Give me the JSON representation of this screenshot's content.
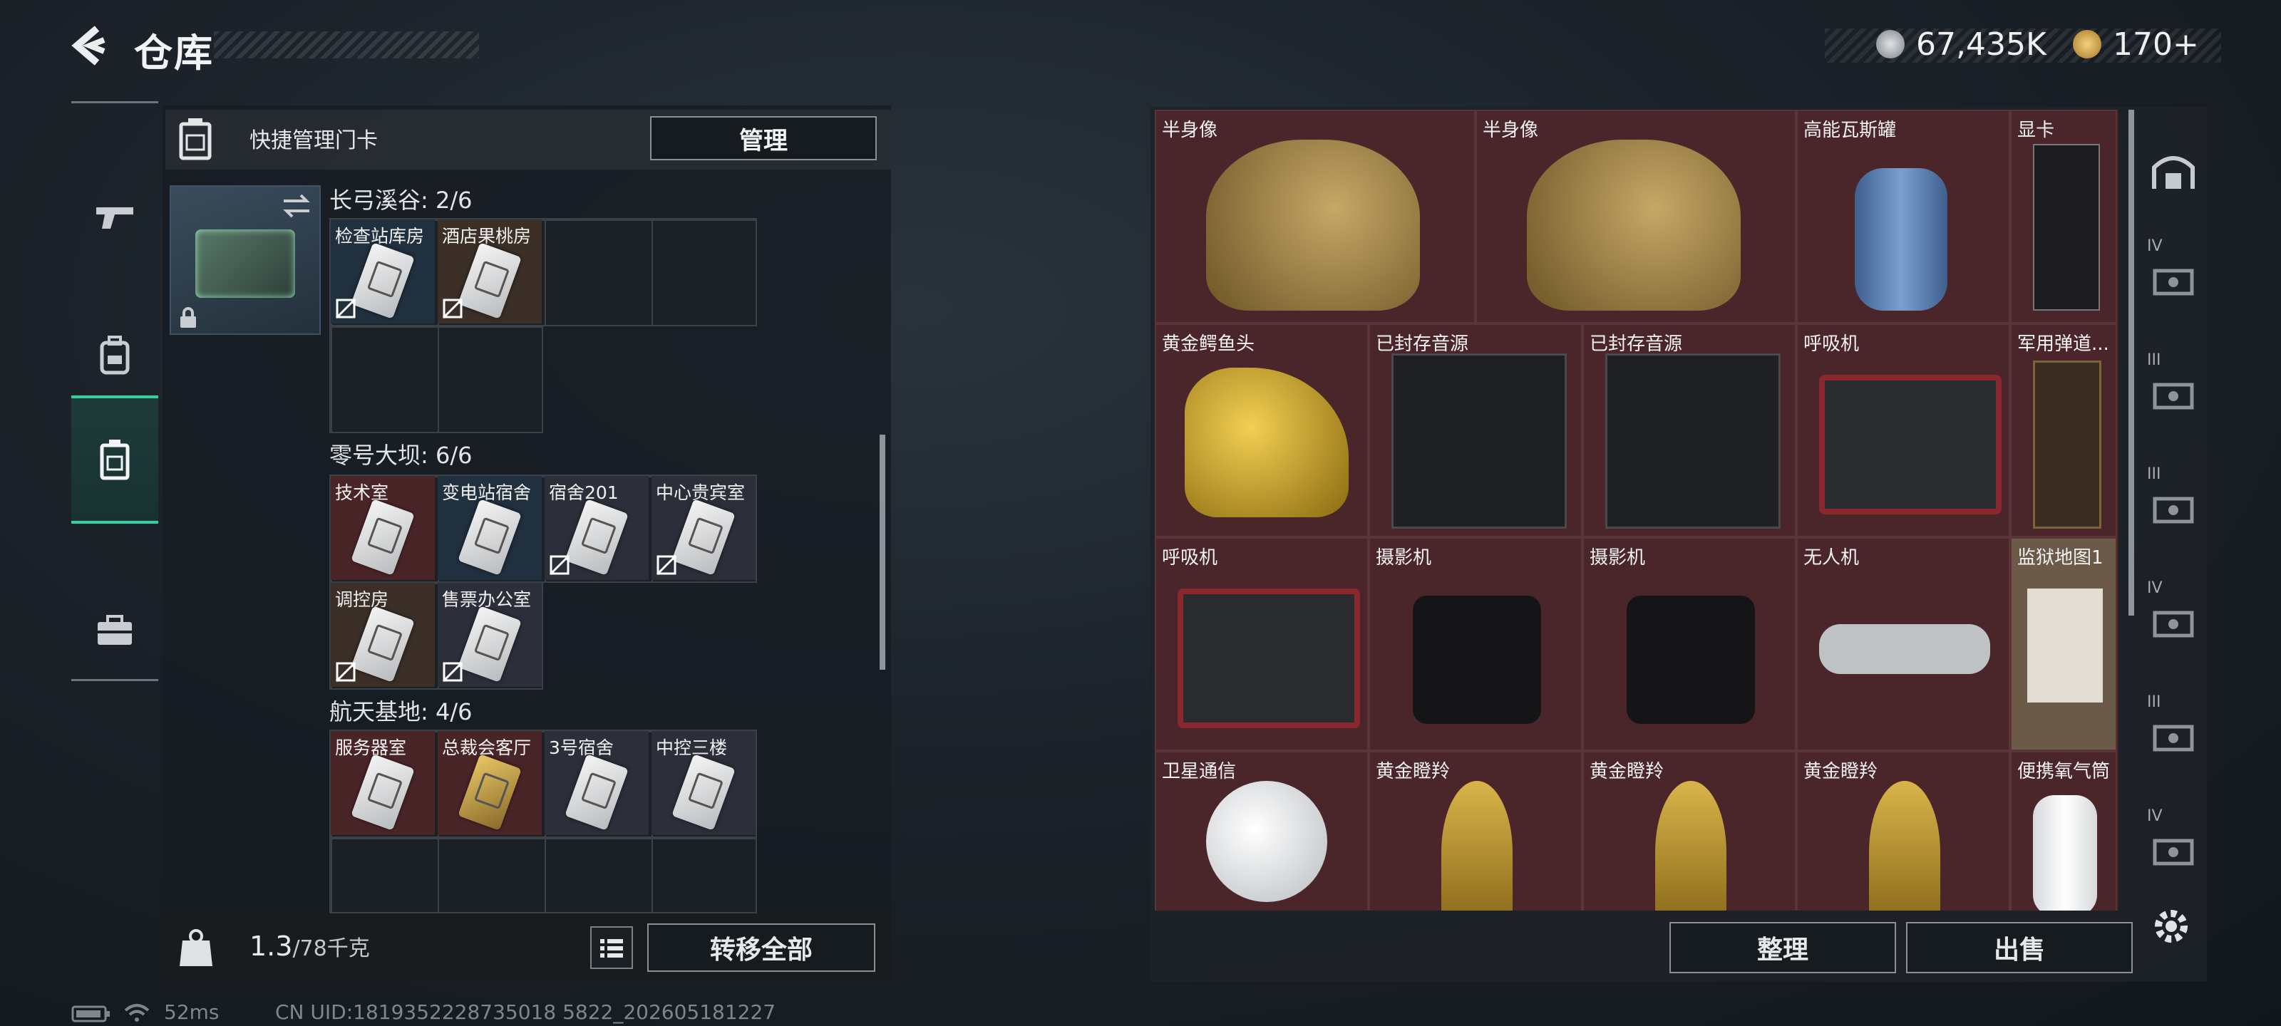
{
  "header": {
    "title": "仓库"
  },
  "currency": {
    "silver": "67,435K",
    "gold": "170+"
  },
  "left_nav": {
    "items": [
      "weapon-tab",
      "equipment-tab",
      "keycard-tab",
      "briefcase-tab"
    ],
    "active": "keycard-tab"
  },
  "quick_panel": {
    "label": "快捷管理门卡",
    "manage_button": "管理"
  },
  "locations": [
    {
      "title": "长弓溪谷: 2/6",
      "cards": [
        "检查站库房",
        "酒店果桃房"
      ]
    },
    {
      "title": "零号大坝: 6/6",
      "cards": [
        "技术室",
        "变电站宿舍",
        "宿舍201",
        "中心贵宾室",
        "调控房",
        "售票办公室"
      ]
    },
    {
      "title": "航天基地: 4/6",
      "cards": [
        "服务器室",
        "总裁会客厅",
        "3号宿舍",
        "中控三楼"
      ]
    }
  ],
  "footer": {
    "weight_value": "1.3",
    "weight_max": "/78千克",
    "transfer_all": "转移全部"
  },
  "items": [
    [
      "半身像",
      "半身像",
      "高能瓦斯罐",
      "显卡"
    ],
    [
      "黄金鳄鱼头",
      "已封存音源",
      "已封存音源",
      "呼吸机",
      "军用弹道..."
    ],
    [
      "呼吸机",
      "摄影机",
      "摄影机",
      "无人机",
      "监狱地图1"
    ],
    [
      "卫星通信",
      "黄金瞪羚",
      "黄金瞪羚",
      "黄金瞪羚",
      "便携氧气筒"
    ]
  ],
  "right_side_tiers": [
    "IV",
    "III",
    "III",
    "IV",
    "III",
    "IV"
  ],
  "bottom_buttons": {
    "sort": "整理",
    "sell": "出售"
  },
  "status_bar": {
    "ping": "52ms",
    "uid": "CN UID:1819352228735018 5822_202605181227"
  }
}
